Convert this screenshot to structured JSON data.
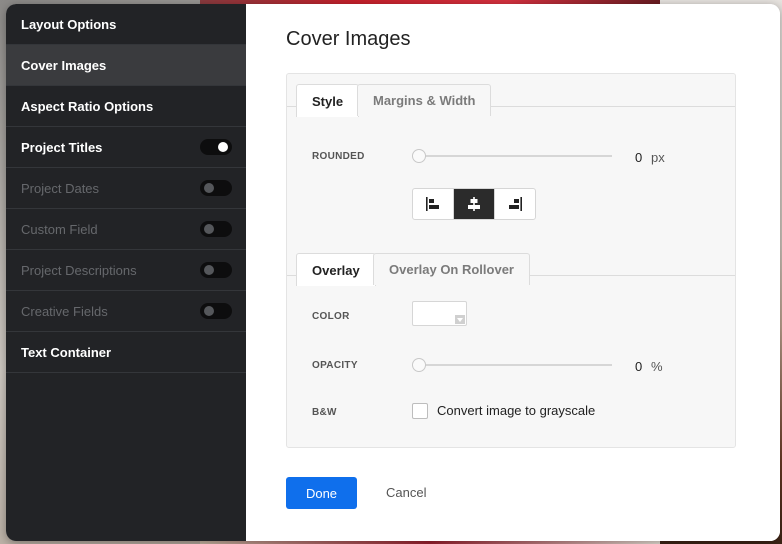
{
  "sidebar": {
    "items": [
      {
        "label": "Layout Options",
        "active": false,
        "disabled": false,
        "toggle": null
      },
      {
        "label": "Cover Images",
        "active": true,
        "disabled": false,
        "toggle": null
      },
      {
        "label": "Aspect Ratio Options",
        "active": false,
        "disabled": false,
        "toggle": null
      },
      {
        "label": "Project Titles",
        "active": false,
        "disabled": false,
        "toggle": "on"
      },
      {
        "label": "Project Dates",
        "active": false,
        "disabled": true,
        "toggle": "off"
      },
      {
        "label": "Custom Field",
        "active": false,
        "disabled": true,
        "toggle": "off"
      },
      {
        "label": "Project Descriptions",
        "active": false,
        "disabled": true,
        "toggle": "off"
      },
      {
        "label": "Creative Fields",
        "active": false,
        "disabled": true,
        "toggle": "off"
      },
      {
        "label": "Text Container",
        "active": false,
        "disabled": false,
        "toggle": null
      }
    ]
  },
  "main": {
    "title": "Cover Images",
    "tabs1": [
      "Style",
      "Margins & Width"
    ],
    "tabs2": [
      "Overlay",
      "Overlay On Rollover"
    ],
    "rounded": {
      "label": "ROUNDED",
      "value": "0",
      "unit": "px",
      "level": 0
    },
    "alignment": {
      "options": [
        "align-left",
        "align-center",
        "align-right"
      ],
      "selected": "align-center"
    },
    "color": {
      "label": "COLOR"
    },
    "opacity": {
      "label": "OPACITY",
      "value": "0",
      "unit": "%",
      "level": 0
    },
    "bw": {
      "label": "B&W",
      "checkbox_label": "Convert image to grayscale",
      "checked": false
    }
  },
  "footer": {
    "done_label": "Done",
    "cancel_label": "Cancel"
  },
  "colors": {
    "primary": "#0f6fec",
    "sidebar": "#222326"
  }
}
